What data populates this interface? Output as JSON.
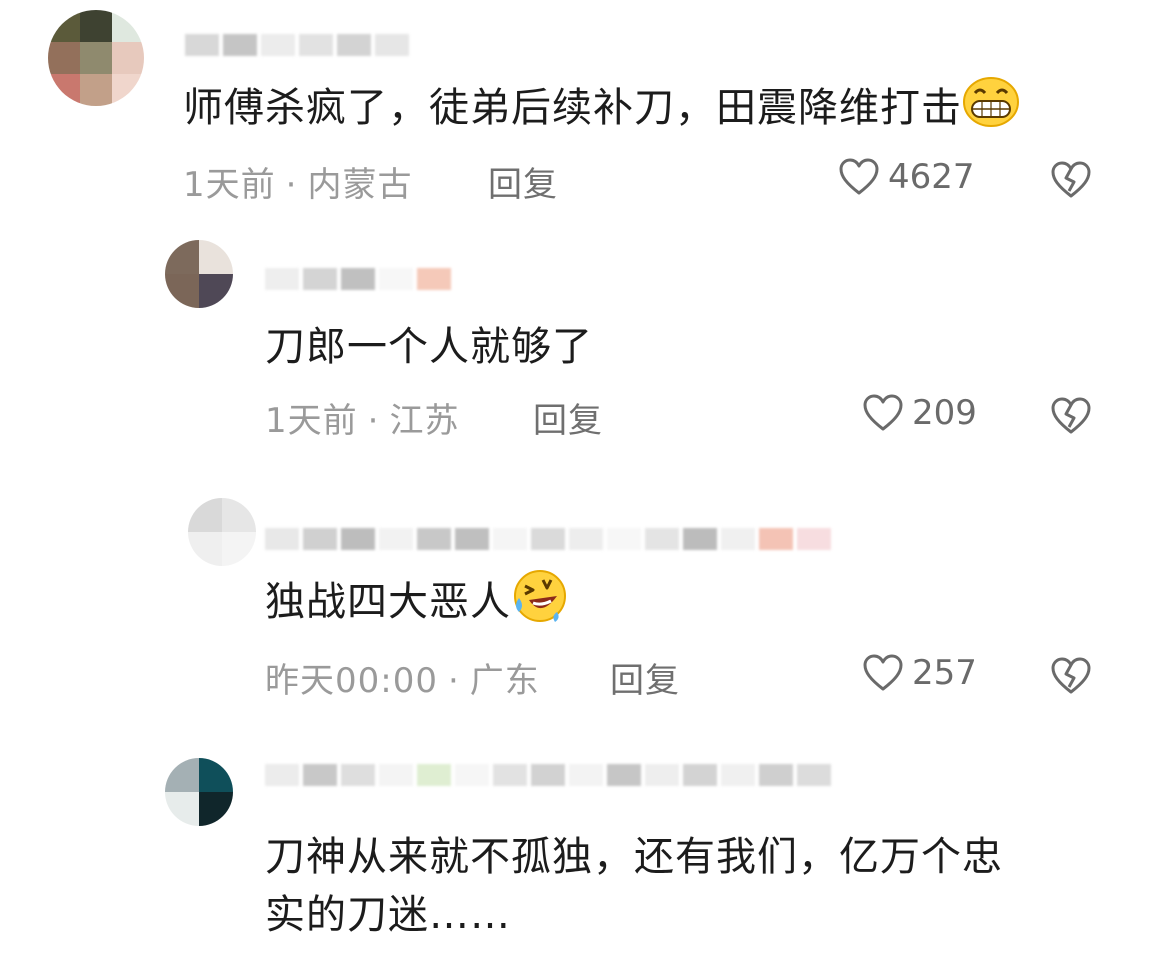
{
  "comments": [
    {
      "text": "师傅杀疯了，徒弟后续补刀，田震降维打击",
      "emoji": "grinning-face-emoji",
      "time": "1天前",
      "location": "内蒙古",
      "reply_label": "回复",
      "likes": "4627"
    },
    {
      "text": "刀郎一个人就够了",
      "time": "1天前",
      "location": "江苏",
      "reply_label": "回复",
      "likes": "209"
    },
    {
      "text": "独战四大恶人",
      "emoji": "rolling-on-floor-laughing-emoji",
      "time": "昨天00:00",
      "location": "广东",
      "reply_label": "回复",
      "likes": "257"
    },
    {
      "text_line1": "刀神从来就不孤独，还有我们，亿万个忠",
      "text_line2": "实的刀迷……"
    }
  ],
  "separator": "·",
  "colors": {
    "text": "#1c1c1c",
    "meta": "#9a9a9a",
    "icon": "#6a6a6a",
    "background": "#ffffff"
  },
  "icons": {
    "like": "heart-outline-icon",
    "dislike": "broken-heart-icon"
  }
}
